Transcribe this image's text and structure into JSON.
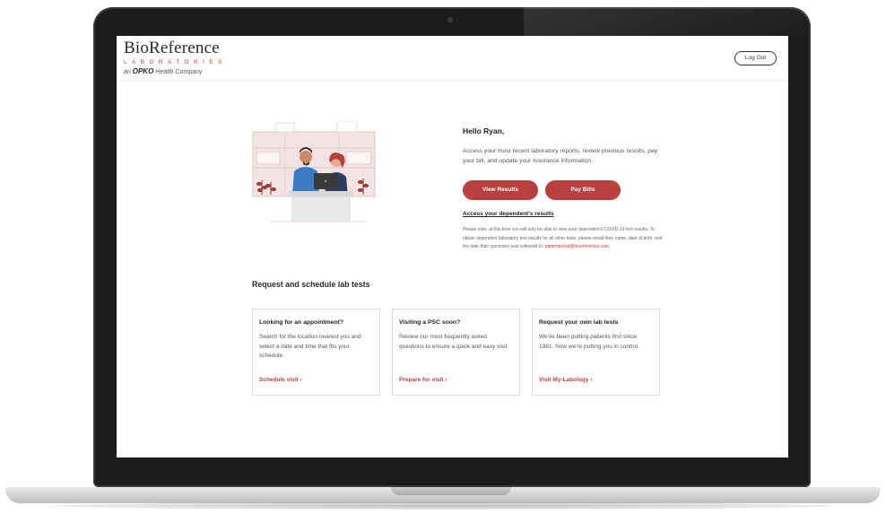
{
  "header": {
    "logo_main": "BioReference",
    "logo_sub": "LABORATORIES",
    "logo_tag_prefix": "an",
    "logo_tag_brand": "OPKO",
    "logo_tag_suffix": "Health Company",
    "logout_label": "Log Out"
  },
  "greeting": {
    "title": "Hello Ryan,",
    "body": "Access your most recent laboratory reports, review previous results, pay your bill, and update your insurance information."
  },
  "actions": {
    "view_results_label": "View Results",
    "pay_bills_label": "Pay Bills"
  },
  "dependent": {
    "link_label": "Access your dependent's results",
    "note": "Please note, at this time you will only be able to view your dependent's COVID-19 test results. To obtain dependent laboratory test results for all other tests, please email their name, date of birth, and the date their specimen was collected to:",
    "email": "patientportal@bioreference.com",
    "note_end": "."
  },
  "lab_tests": {
    "title": "Request and schedule lab tests",
    "cards": [
      {
        "title": "Looking for an appointment?",
        "body": "Search for the location nearest you and select a date and time that fits your schedule.",
        "link": "Schedule visit  ›"
      },
      {
        "title": "Visiting a PSC soon?",
        "body": "Review our most frequently asked questions to ensure a quick and easy visit.",
        "link": "Prepare for visit  ›"
      },
      {
        "title": "Request your own lab tests",
        "body": "We've been putting patients first since 1981. Now we're putting you in control.",
        "link": "Visit My-Labology  ›"
      }
    ]
  },
  "colors": {
    "accent": "#b8413d",
    "laptop_bezel": "#1c1c1e",
    "text_dark": "#222222"
  }
}
